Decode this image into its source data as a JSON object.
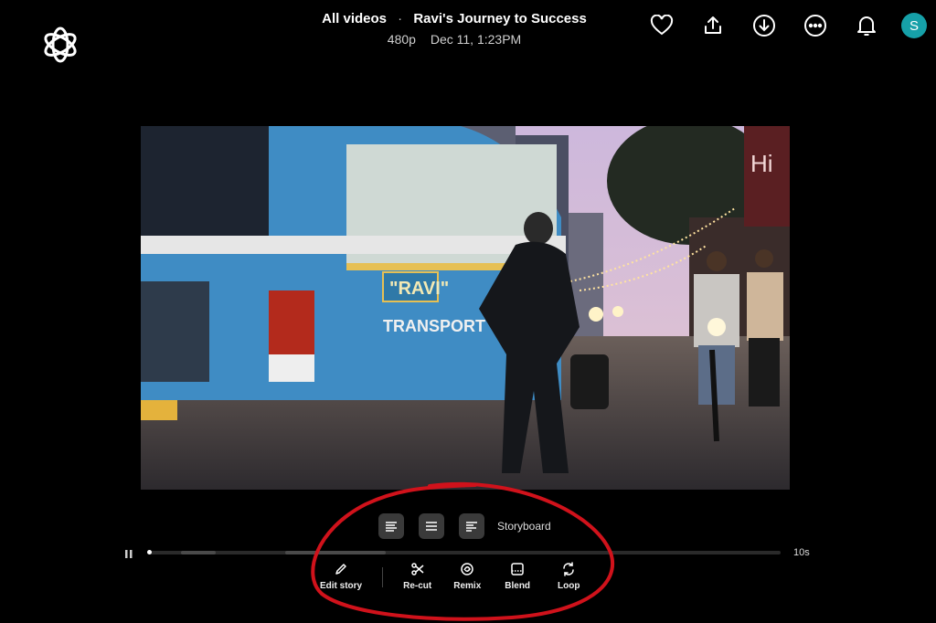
{
  "header": {
    "breadcrumb": "All videos",
    "separator": "·",
    "title": "Ravi's Journey to Success",
    "resolution": "480p",
    "timestamp": "Dec 11, 1:23PM"
  },
  "actions": {
    "items": [
      {
        "name": "favorite",
        "icon": "heart-icon"
      },
      {
        "name": "share",
        "icon": "upload-icon"
      },
      {
        "name": "download",
        "icon": "download-icon"
      },
      {
        "name": "more",
        "icon": "more-icon"
      },
      {
        "name": "notifications",
        "icon": "bell-icon"
      }
    ],
    "avatar_letter": "S",
    "avatar_color": "#16a0a8"
  },
  "video": {
    "bus_sign": "\"RAVI\"",
    "bus_text": "TRANSPORT",
    "shop_sign": "Hi"
  },
  "storyboard": {
    "label": "Storyboard"
  },
  "player": {
    "duration": "10s",
    "progress": 0.0
  },
  "tools": [
    {
      "label": "Edit story",
      "icon": "pencil-icon"
    },
    {
      "label": "Re-cut",
      "icon": "scissors-icon"
    },
    {
      "label": "Remix",
      "icon": "remix-icon"
    },
    {
      "label": "Blend",
      "icon": "blend-icon"
    },
    {
      "label": "Loop",
      "icon": "loop-icon"
    }
  ],
  "colors": {
    "background": "#000000",
    "annotation": "#d0121b"
  }
}
